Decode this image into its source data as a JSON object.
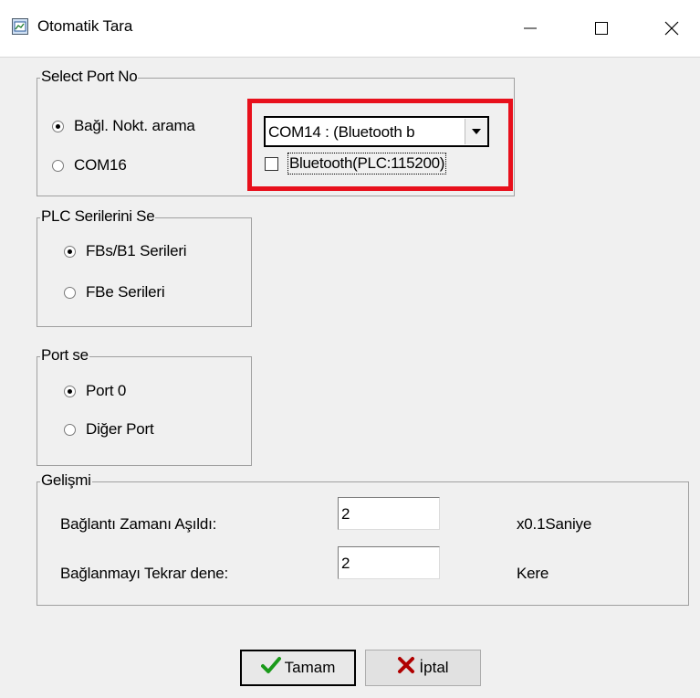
{
  "window": {
    "title": "Otomatik Tara"
  },
  "icons": {
    "app": "scan-app-icon",
    "minimize": "minimize-icon",
    "maximize": "maximize-icon",
    "close": "close-icon",
    "ok": "checkmark-icon",
    "cancel": "x-icon"
  },
  "port_group": {
    "legend": "Select Port No",
    "options": [
      {
        "label": "Bağl. Nokt. arama",
        "selected": true
      },
      {
        "label": "COM16",
        "selected": false
      }
    ],
    "combo_value": "COM14 : (Bluetooth b",
    "bluetooth_checkbox": {
      "label": "Bluetooth(PLC:115200)",
      "checked": false
    }
  },
  "plc_group": {
    "legend": "PLC Serilerini Se",
    "options": [
      {
        "label": "FBs/B1 Serileri",
        "selected": true
      },
      {
        "label": "FBe Serileri",
        "selected": false
      }
    ]
  },
  "portse_group": {
    "legend": "Port se",
    "options": [
      {
        "label": "Port 0",
        "selected": true
      },
      {
        "label": "Diğer Port",
        "selected": false
      }
    ]
  },
  "advanced_group": {
    "legend": "Gelişmi",
    "timeout": {
      "label": "Bağlantı Zamanı Aşıldı:",
      "value": "2",
      "unit": "x0.1Saniye"
    },
    "retry": {
      "label": "Bağlanmayı Tekrar dene:",
      "value": "2",
      "unit": "Kere"
    }
  },
  "buttons": {
    "ok": "Tamam",
    "cancel": "İptal"
  },
  "colors": {
    "highlight": "#e8101c",
    "dialog_bg": "#f0f0f0",
    "ok_check": "#1a9a1a",
    "cancel_x": "#b00000"
  }
}
